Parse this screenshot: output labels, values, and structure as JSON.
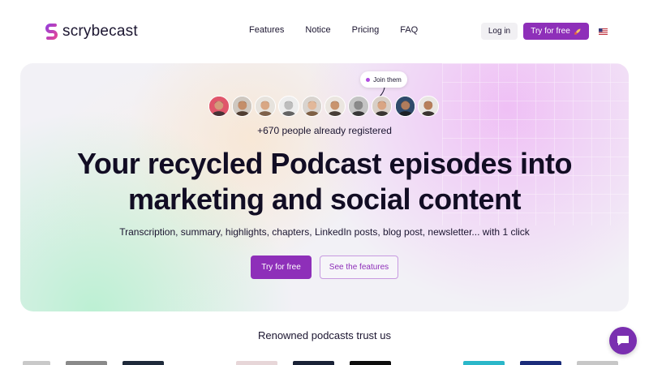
{
  "brand": {
    "name": "scrybecast",
    "accent": "#8e2fb9"
  },
  "nav": {
    "links": [
      "Features",
      "Notice",
      "Pricing",
      "FAQ"
    ],
    "login_label": "Log in",
    "try_label": "Try for free",
    "try_icon": "rocket-icon",
    "language_flag": "us-flag-icon"
  },
  "hero": {
    "join_label": "Join them",
    "avatars": [
      {
        "bg": "#e0566b",
        "skin": "#d49a7a",
        "hair": "#2b2b2b"
      },
      {
        "bg": "#cfc8c0",
        "skin": "#c48e6a",
        "hair": "#3a2418"
      },
      {
        "bg": "#e7e3dd",
        "skin": "#d9a784",
        "hair": "#6b4a30"
      },
      {
        "bg": "#ededed",
        "skin": "#bdbdbd",
        "hair": "#4a4a4a"
      },
      {
        "bg": "#d9d4cf",
        "skin": "#e2b89a",
        "hair": "#6d4a2b"
      },
      {
        "bg": "#ebe6e0",
        "skin": "#c9946e",
        "hair": "#2a1f18"
      },
      {
        "bg": "#c4c4c4",
        "skin": "#8a8a8a",
        "hair": "#1f1f1f"
      },
      {
        "bg": "#d8cfc7",
        "skin": "#d9a583",
        "hair": "#1d1a18"
      },
      {
        "bg": "#2f4a6b",
        "skin": "#b07c5c",
        "hair": "#1a1a1a"
      },
      {
        "bg": "#e9e6e2",
        "skin": "#b77f5a",
        "hair": "#1b1410"
      }
    ],
    "registered": "+670 people already registered",
    "headline_line1": "Your recycled Podcast episodes into",
    "headline_line2": "marketing and social content",
    "subline": "Transcription, summary, highlights, chapters, LinkedIn posts, blog post, newsletter... with 1 click",
    "cta_primary": "Try for free",
    "cta_secondary": "See the features"
  },
  "trust": {
    "title": "Renowned podcasts trust us",
    "logo_colors": [
      "#c9c9c9",
      "#8a8a8a",
      "#1f2a3a",
      "#e7d6d8",
      "#1a2236",
      "#0e0e0e",
      "#2bb7c9",
      "#1b2c7a",
      "#c7c7c7"
    ]
  },
  "chat": {
    "icon": "chat-bubble-icon"
  }
}
